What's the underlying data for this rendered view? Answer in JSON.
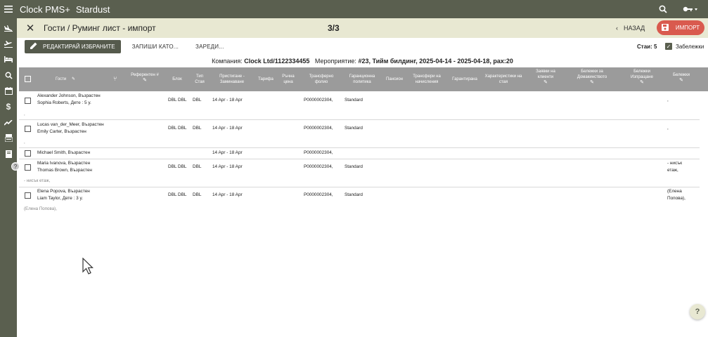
{
  "appbar": {
    "title": "Clock PMS+",
    "hotel": "Stardust",
    "menu_icon": "menu-icon",
    "search_icon": "search-icon",
    "key_icon": "key-icon"
  },
  "sidebar": {
    "items": [
      "plane-arrival-icon",
      "plane-departure-icon",
      "bed-icon",
      "search-icon",
      "calendar-icon",
      "dollar-icon",
      "trend-icon",
      "register-icon",
      "book-icon"
    ],
    "badge": "?"
  },
  "titlebar": {
    "title": "Гости / Руминг лист - импорт",
    "pager": "3/3",
    "back_label": "НАЗАД",
    "import_label": "ИМПОРТ"
  },
  "toolbar": {
    "edit_label": "РЕДАКТИРАЙ ИЗБРАНИТЕ",
    "save_as_label": "ЗАПИШИ КАТО...",
    "load_label": "ЗАРЕДИ...",
    "rooms_label": "Стаи: 5",
    "notes_label": "Забележки"
  },
  "company": {
    "label_company": "Компания:",
    "company_name": "Clock Ltd/1122334455",
    "label_event": "Мероприятие:",
    "event_name": "#23, Тийм билдинг, 2025-04-14 - 2025-04-18, pax:20"
  },
  "columns": {
    "guests": "Гости",
    "referent": "Референтен #",
    "block": "Блок",
    "room_type": "Тип Стая",
    "arrival_departure": "Пристигане - Заминаване",
    "tariff": "Тарифа",
    "manual_price": "Ръчна цена",
    "transfer_folio": "Трансферно фолио",
    "guarantee_policy": "Гаранционна политика",
    "board": "Пансион",
    "transfer_charges": "Трансфери на начисления",
    "guaranteed": "Гарантирана",
    "room_features": "Характеристики на стая",
    "client_requests": "Заявки на клиенти",
    "housekeeping_notes": "Бележки за Домакинството",
    "checkout_notes": "Бележки Изпращане",
    "notes": "Бележки"
  },
  "rows": [
    {
      "guest1": "Alexander Johnson, Възрастен",
      "guest2": "Sophia Roberts, Дете : 5 y.",
      "block": "DBL DBL",
      "room_type": "DBL",
      "dates": "14 Apr - 18 Apr",
      "folio": "P0000002304,",
      "policy": "Standard",
      "notes": ",",
      "sub_note": ","
    },
    {
      "guest1": "Lucas van_der_Meer, Възрастен",
      "guest2": "Emily Carter, Възрастен",
      "block": "DBL DBL",
      "room_type": "DBL",
      "dates": "14 Apr - 18 Apr",
      "folio": "P0000002304,",
      "policy": "Standard",
      "notes": ",",
      "sub_note": ","
    },
    {
      "guest1": "Michael Smith, Възрастен",
      "dates": "14 Apr - 18 Apr",
      "folio": "P0000002304,"
    },
    {
      "guest1": "Maria Ivanova, Възрастен",
      "guest2": "Thomas Brown, Възрастен",
      "block": "DBL DBL",
      "room_type": "DBL",
      "dates": "14 Apr - 18 Apr",
      "folio": "P0000002304,",
      "policy": "Standard",
      "notes1": "- нисък",
      "notes2": "етаж,",
      "sub_note": "- нисък етаж,"
    },
    {
      "guest1": "Elena Popova, Възрастен",
      "guest2": "Liam Taylor, Дете : 3 y.",
      "block": "DBL DBL",
      "room_type": "DBL",
      "dates": "14 Apr - 18 Apr",
      "folio": "P0000002304,",
      "policy": "Standard",
      "notes1": "(Елена",
      "notes2": "Попова),",
      "sub_note": "(Елена Попова),"
    }
  ],
  "help": "?"
}
